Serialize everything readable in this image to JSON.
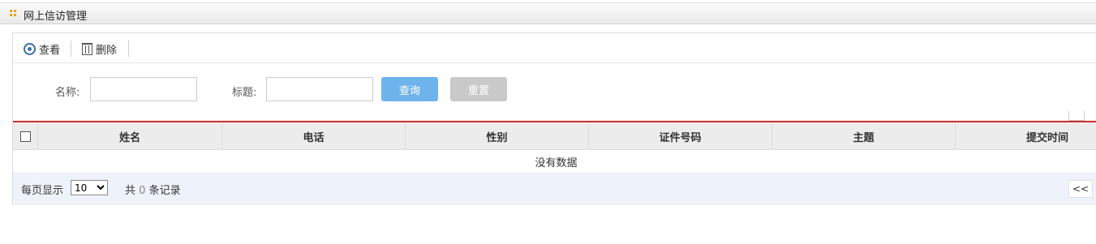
{
  "window": {
    "title": "网上信访管理"
  },
  "toolbar": {
    "view_label": "查看",
    "delete_label": "删除"
  },
  "search": {
    "name_label": "名称:",
    "name_value": "",
    "title_label": "标题:",
    "title_value": "",
    "query_label": "查询",
    "reset_label": "重置"
  },
  "table": {
    "columns": [
      "姓名",
      "电话",
      "性别",
      "证件号码",
      "主题",
      "提交时间"
    ],
    "rows": [],
    "empty_text": "没有数据"
  },
  "pager": {
    "per_page_label": "每页显示",
    "page_size": "10",
    "total_prefix": "共",
    "total_count": "0",
    "total_suffix": "条记录",
    "prev_label": "<<"
  },
  "colors": {
    "accent": "#c9302c",
    "query_button": "#6fb3ec",
    "reset_button": "#c9c9c9"
  }
}
